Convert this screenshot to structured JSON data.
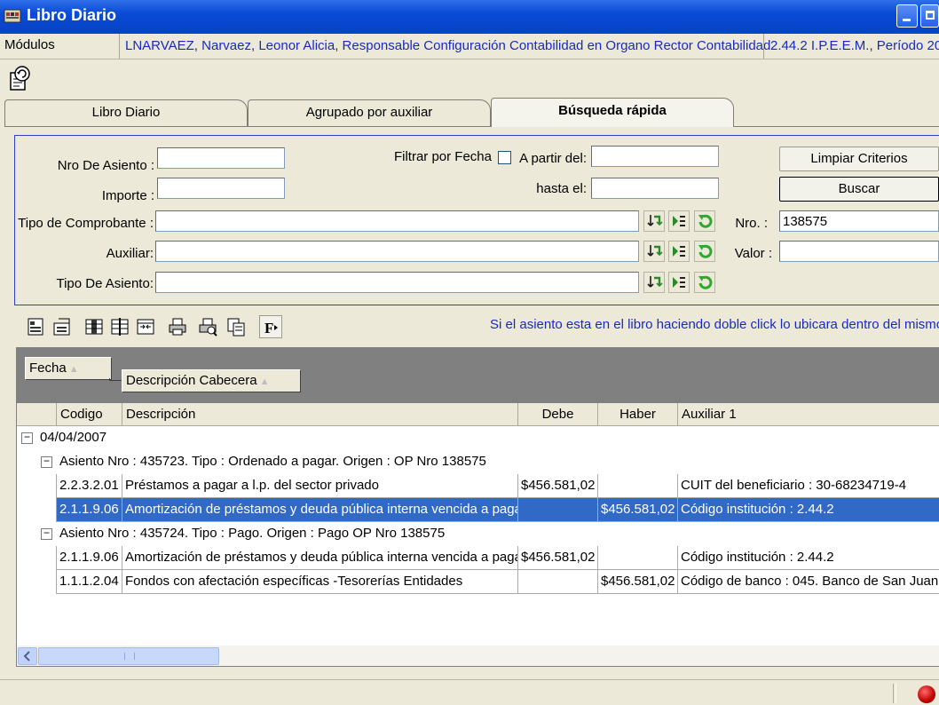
{
  "window": {
    "title": "Libro Diario"
  },
  "menubar": {
    "modules_label": "Módulos",
    "user_info": "LNARVAEZ, Narvaez, Leonor Alicia, Responsable Configuración Contabilidad en Organo Rector Contabilidad",
    "entity_info": "2.44.2 I.P.E.E.M., Período 20"
  },
  "tabs": [
    {
      "label": "Libro Diario"
    },
    {
      "label": "Agrupado por auxiliar"
    },
    {
      "label": "Búsqueda rápida"
    }
  ],
  "criteria": {
    "nro_asiento_label": "Nro De Asiento :",
    "nro_asiento_value": "",
    "importe_label": "Importe :",
    "importe_value": "",
    "filtrar_fecha_label": "Filtrar por Fecha",
    "filtrar_fecha_checked": false,
    "a_partir_label": "A partir del:",
    "a_partir_value": "",
    "hasta_label": "hasta el:",
    "hasta_value": "",
    "tipo_comprobante_label": "Tipo de Comprobante :",
    "tipo_comprobante_value": "",
    "auxiliar_label": "Auxiliar:",
    "auxiliar_value": "",
    "tipo_asiento_label": "Tipo De Asiento:",
    "tipo_asiento_value": "",
    "limpiar_label": "Limpiar Criterios",
    "buscar_label": "Buscar",
    "nro_label": "Nro. :",
    "nro_value": "138575",
    "valor_label": "Valor :",
    "valor_value": ""
  },
  "hint": "Si el asiento esta en el libro haciendo doble click lo ubicara dentro del mismo",
  "grid": {
    "group_chips": [
      "Fecha",
      "Descripción Cabecera"
    ],
    "columns": [
      "Codigo",
      "Descripción",
      "Debe",
      "Haber",
      "Auxiliar 1"
    ],
    "date_group": "04/04/2007",
    "asientos": [
      {
        "header": "Asiento Nro : 435723. Tipo : Ordenado a pagar. Origen : OP Nro 138575",
        "rows": [
          {
            "codigo": "2.2.3.2.01",
            "descripcion": "Préstamos a pagar a l.p. del sector privado",
            "debe": "$456.581,02",
            "haber": "",
            "auxiliar": "CUIT del beneficiario : 30-68234719-4",
            "selected": false
          },
          {
            "codigo": "2.1.1.9.06",
            "descripcion": "Amortización de préstamos y deuda pública interna vencida a pagar",
            "debe": "",
            "haber": "$456.581,02",
            "auxiliar": "Código institución  : 2.44.2",
            "selected": true
          }
        ]
      },
      {
        "header": "Asiento Nro : 435724. Tipo : Pago. Origen : Pago OP Nro  138575",
        "rows": [
          {
            "codigo": "2.1.1.9.06",
            "descripcion": "Amortización de préstamos y deuda pública interna vencida a pagar",
            "debe": "$456.581,02",
            "haber": "",
            "auxiliar": "Código institución  : 2.44.2",
            "selected": false
          },
          {
            "codigo": "1.1.1.2.04",
            "descripcion": "Fondos con afectación específicas -Tesorerías Entidades",
            "debe": "",
            "haber": "$456.581,02",
            "auxiliar": "Código de banco : 045. Banco de San Juan",
            "selected": false
          }
        ]
      }
    ]
  },
  "toolbar_icons": [
    "report-icon",
    "export-icon",
    "columns-icon",
    "split-columns-icon",
    "merge-columns-icon",
    "print-icon",
    "print-preview-icon",
    "copy-icon",
    "font-icon"
  ],
  "colors": {
    "accent": "#316ac5",
    "title_bar": "#0a4ad6",
    "link_text": "#1a2ac0"
  }
}
